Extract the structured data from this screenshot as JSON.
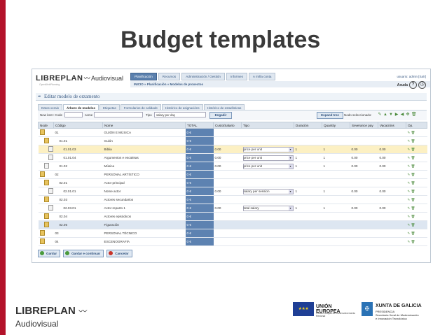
{
  "slide": {
    "title": "Budget templates"
  },
  "app": {
    "logo_text": "LIBREPLAN",
    "logo_suffix": "Audiovisual",
    "logo_tagline": "OpenWebPlanning",
    "nav_tabs": [
      "Planificación",
      "Recursos",
      "Administración / Gestión",
      "Informes",
      "A miña conta"
    ],
    "user_label": "usuario: admin",
    "logout_label": "[Saír]",
    "breadcrumb": "INICIO » Planificación » Modelos de proxectos",
    "help_label": "Axuda",
    "help_icon_glyph": "?",
    "section_title": "Editar modelo de orzamento"
  },
  "tabs": [
    "Datos xerais",
    "Árbore de modelos",
    "Etiquetas",
    "Formularios de calidade",
    "Histórico de asignacións",
    "Histórico de estadísticas"
  ],
  "toolbar": {
    "new_item_label": "New item: Code",
    "name_label": "nome",
    "type_label": "Tipo",
    "type_value": "salary per day",
    "add_button": "Engadir",
    "expand_button": "Expand tree",
    "selected_node_label": "Nodo seleccionado:"
  },
  "grid": {
    "headers": [
      "Node",
      "Código",
      "Nome",
      "TOTAL",
      "Custo/Salario",
      "Tipo",
      "Duración",
      "Quantity",
      "Severance pay",
      "Vacacións",
      "Op."
    ],
    "rows": [
      {
        "node": "folder",
        "indent": 0,
        "code": "01",
        "name": "GUIÓN E MÚSICA",
        "total": "0 €",
        "cost": "",
        "type": "",
        "duration": "",
        "quantity": "",
        "severance": "",
        "vacations": "",
        "style": ""
      },
      {
        "node": "folder",
        "indent": 1,
        "code": "01.01",
        "name": "Guión",
        "total": "0 €",
        "cost": "",
        "type": "",
        "duration": "",
        "quantity": "",
        "severance": "",
        "vacations": "",
        "style": ""
      },
      {
        "node": "leaf",
        "indent": 2,
        "code": "01.01.03",
        "name": "Biblia",
        "total": "0 €",
        "cost": "0.00",
        "type": "price per unit",
        "duration": "1",
        "quantity": "1",
        "severance": "0.00",
        "vacations": "0.00",
        "style": "sel"
      },
      {
        "node": "leaf",
        "indent": 2,
        "code": "01.01.04",
        "name": "Argumentos e escaletas",
        "total": "0 €",
        "cost": "0.00",
        "type": "price per unit",
        "duration": "1",
        "quantity": "1",
        "severance": "0.00",
        "vacations": "0.00",
        "style": ""
      },
      {
        "node": "leaf",
        "indent": 1,
        "code": "01.02",
        "name": "Música",
        "total": "0 €",
        "cost": "0.00",
        "type": "price per unit",
        "duration": "1",
        "quantity": "1",
        "severance": "0.00",
        "vacations": "0.00",
        "style": ""
      },
      {
        "node": "folder",
        "indent": 0,
        "code": "02",
        "name": "PERSONAL ARTÍSTICO",
        "total": "0 €",
        "cost": "",
        "type": "",
        "duration": "",
        "quantity": "",
        "severance": "",
        "vacations": "",
        "style": ""
      },
      {
        "node": "folder",
        "indent": 1,
        "code": "02.01",
        "name": "Actor principal",
        "total": "0 €",
        "cost": "",
        "type": "",
        "duration": "",
        "quantity": "",
        "severance": "",
        "vacations": "",
        "style": ""
      },
      {
        "node": "leaf",
        "indent": 2,
        "code": "02.01.01",
        "name": "Nome actor",
        "total": "0 €",
        "cost": "0.00",
        "type": "salary per session",
        "duration": "1",
        "quantity": "1",
        "severance": "0.00",
        "vacations": "0.00",
        "style": ""
      },
      {
        "node": "folder",
        "indent": 1,
        "code": "02.03",
        "name": "Actores secundarios",
        "total": "0 €",
        "cost": "",
        "type": "",
        "duration": "",
        "quantity": "",
        "severance": "",
        "vacations": "",
        "style": ""
      },
      {
        "node": "leaf",
        "indent": 2,
        "code": "02.03.01",
        "name": "Actor reparto 1",
        "total": "0 €",
        "cost": "0.00",
        "type": "total salary",
        "duration": "1",
        "quantity": "1",
        "severance": "0.00",
        "vacations": "0.00",
        "style": ""
      },
      {
        "node": "folder",
        "indent": 1,
        "code": "02.04",
        "name": "Actores episódicos",
        "total": "0 €",
        "cost": "",
        "type": "",
        "duration": "",
        "quantity": "",
        "severance": "",
        "vacations": "",
        "style": ""
      },
      {
        "node": "folder",
        "indent": 1,
        "code": "02.05",
        "name": "Figuración",
        "total": "0 €",
        "cost": "",
        "type": "",
        "duration": "",
        "quantity": "",
        "severance": "",
        "vacations": "",
        "style": "hl"
      },
      {
        "node": "folder",
        "indent": 0,
        "code": "03",
        "name": "PERSONAL TÉCNICO",
        "total": "0 €",
        "cost": "",
        "type": "",
        "duration": "",
        "quantity": "",
        "severance": "",
        "vacations": "",
        "style": ""
      },
      {
        "node": "folder",
        "indent": 0,
        "code": "04",
        "name": "ESCENOGRAFÍA",
        "total": "0 €",
        "cost": "",
        "type": "",
        "duration": "",
        "quantity": "",
        "severance": "",
        "vacations": "",
        "style": ""
      }
    ]
  },
  "footer": {
    "save": "Gardar",
    "save_continue": "Gardar e continuar",
    "cancel": "Cancelar"
  },
  "bottom": {
    "logo_text": "LIBREPLAN",
    "logo_suffix": "Audiovisual",
    "eu_name": "UNIÓN EUROPEA",
    "eu_fund": "Fondo Europeo de Desenvolvemento Rexional",
    "xunta_name": "XUNTA DE GALICIA",
    "xunta_line1": "PRESIDENCIA",
    "xunta_line2": "Secretaría Xeral de Modernización",
    "xunta_line3": "e Innovación Tecnolóxica"
  },
  "colors": {
    "accent": "#b3122a",
    "nav_active": "#5b80ad",
    "total_cell": "#5d82b1",
    "selected_row": "#fcf0c3"
  }
}
